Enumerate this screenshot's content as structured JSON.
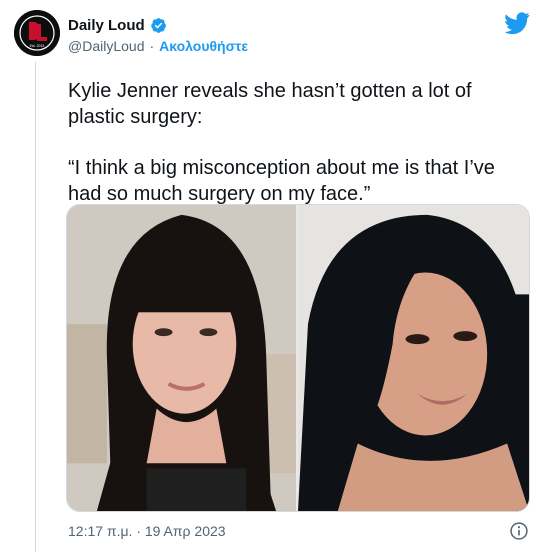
{
  "tweet": {
    "display_name": "Daily Loud",
    "handle": "@DailyLoud",
    "separator": "·",
    "follow_label": "Ακολουθήστε",
    "text_line1": "Kylie Jenner reveals she hasn’t gotten a lot of plastic surgery:",
    "text_line2": "“I think a big misconception about me is that I’ve had so much surgery on my face.”",
    "timestamp": "12:17 π.μ. · 19 Απρ 2023",
    "avatar_logo_text": "DL",
    "icons": {
      "verified": "verified-badge-icon",
      "platform": "twitter-bird-icon",
      "info": "info-icon"
    },
    "colors": {
      "accent": "#1d9bf0",
      "text": "#0f1419",
      "muted": "#536471",
      "avatar_bg": "#0d0d0d",
      "avatar_logo": "#c8102e"
    }
  }
}
